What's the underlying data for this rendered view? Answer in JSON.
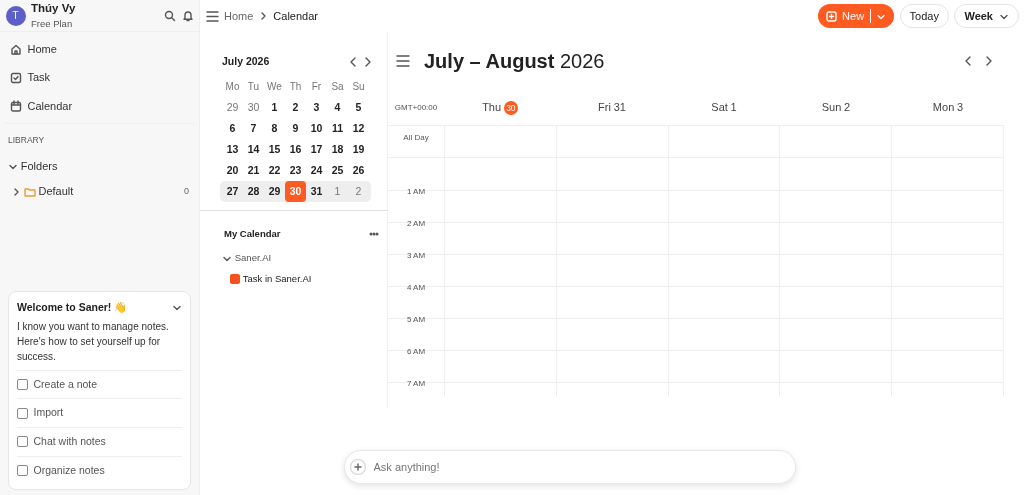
{
  "user": {
    "initial": "T",
    "name": "Thúy Vy",
    "plan": "Free Plan"
  },
  "nav": [
    {
      "label": "Home"
    },
    {
      "label": "Task"
    },
    {
      "label": "Calendar"
    }
  ],
  "library": {
    "heading": "LIBRARY",
    "folders": {
      "label": "Folders",
      "expanded": true,
      "children": [
        {
          "label": "Default",
          "count": "0",
          "expanded": false
        }
      ]
    }
  },
  "welcome": {
    "title": "Welcome to Saner! 👋",
    "text": "I know you want to manage notes. Here's how to set yourself up for success.",
    "expanded": true,
    "items": [
      {
        "label": "Create a note",
        "checked": false
      },
      {
        "label": "Import",
        "checked": false
      },
      {
        "label": "Chat with notes",
        "checked": false
      },
      {
        "label": "Organize notes",
        "checked": false
      }
    ]
  },
  "breadcrumb": [
    "Home",
    "Calendar"
  ],
  "toolbar": {
    "new": "New",
    "today": "Today",
    "view": "Week"
  },
  "mini_calendar": {
    "title": "July 2026",
    "weekdays": [
      "Mo",
      "Tu",
      "We",
      "Th",
      "Fr",
      "Sa",
      "Su"
    ],
    "weeks": [
      {
        "current": false,
        "days": [
          {
            "label": "29",
            "muted": true,
            "selected": false
          },
          {
            "label": "30",
            "muted": true,
            "selected": false
          },
          {
            "label": "1",
            "muted": false,
            "selected": false
          },
          {
            "label": "2",
            "muted": false,
            "selected": false
          },
          {
            "label": "3",
            "muted": false,
            "selected": false
          },
          {
            "label": "4",
            "muted": false,
            "selected": false
          },
          {
            "label": "5",
            "muted": false,
            "selected": false
          }
        ]
      },
      {
        "current": false,
        "days": [
          {
            "label": "6",
            "muted": false,
            "selected": false
          },
          {
            "label": "7",
            "muted": false,
            "selected": false
          },
          {
            "label": "8",
            "muted": false,
            "selected": false
          },
          {
            "label": "9",
            "muted": false,
            "selected": false
          },
          {
            "label": "10",
            "muted": false,
            "selected": false
          },
          {
            "label": "11",
            "muted": false,
            "selected": false
          },
          {
            "label": "12",
            "muted": false,
            "selected": false
          }
        ]
      },
      {
        "current": false,
        "days": [
          {
            "label": "13",
            "muted": false,
            "selected": false
          },
          {
            "label": "14",
            "muted": false,
            "selected": false
          },
          {
            "label": "15",
            "muted": false,
            "selected": false
          },
          {
            "label": "16",
            "muted": false,
            "selected": false
          },
          {
            "label": "17",
            "muted": false,
            "selected": false
          },
          {
            "label": "18",
            "muted": false,
            "selected": false
          },
          {
            "label": "19",
            "muted": false,
            "selected": false
          }
        ]
      },
      {
        "current": false,
        "days": [
          {
            "label": "20",
            "muted": false,
            "selected": false
          },
          {
            "label": "21",
            "muted": false,
            "selected": false
          },
          {
            "label": "22",
            "muted": false,
            "selected": false
          },
          {
            "label": "23",
            "muted": false,
            "selected": false
          },
          {
            "label": "24",
            "muted": false,
            "selected": false
          },
          {
            "label": "25",
            "muted": false,
            "selected": false
          },
          {
            "label": "26",
            "muted": false,
            "selected": false
          }
        ]
      },
      {
        "current": true,
        "days": [
          {
            "label": "27",
            "muted": false,
            "selected": false
          },
          {
            "label": "28",
            "muted": false,
            "selected": false
          },
          {
            "label": "29",
            "muted": false,
            "selected": false
          },
          {
            "label": "30",
            "muted": false,
            "selected": true
          },
          {
            "label": "31",
            "muted": false,
            "selected": false
          },
          {
            "label": "1",
            "muted": true,
            "selected": false
          },
          {
            "label": "2",
            "muted": true,
            "selected": false
          }
        ]
      }
    ]
  },
  "my_calendar": {
    "heading": "My Calendar",
    "groups": [
      {
        "label": "Saner.AI",
        "expanded": true,
        "children": [
          {
            "label": "Task in Saner.AI",
            "color": "#f4511e"
          }
        ]
      }
    ]
  },
  "week_view": {
    "title_bold": "July – August",
    "title_year": "2026",
    "timezone": "GMT+00:00",
    "days": [
      {
        "name": "Thu",
        "date": "30",
        "today": true
      },
      {
        "name": "Fri",
        "date": "31",
        "today": false
      },
      {
        "name": "Sat",
        "date": "1",
        "today": false
      },
      {
        "name": "Sun",
        "date": "2",
        "today": false
      },
      {
        "name": "Mon",
        "date": "3",
        "today": false
      }
    ],
    "all_day": "All Day",
    "hours": [
      "1 AM",
      "2 AM",
      "3 AM",
      "4 AM",
      "5 AM",
      "6 AM",
      "7 AM"
    ]
  },
  "ask": {
    "placeholder": "Ask anything!"
  }
}
